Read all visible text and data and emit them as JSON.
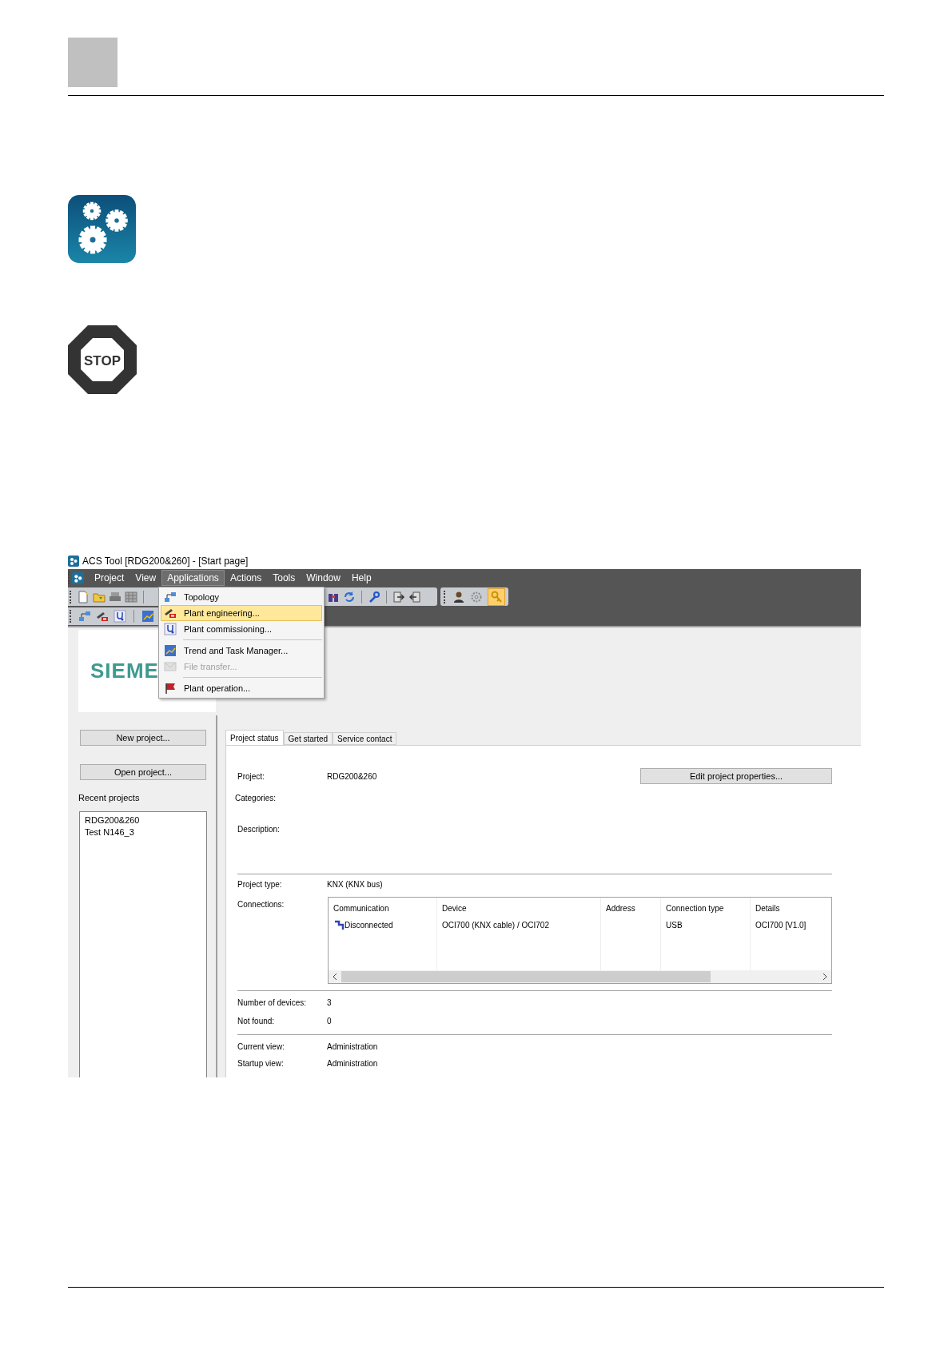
{
  "stop_sign": {
    "label": "STOP"
  },
  "window": {
    "title": "ACS Tool [RDG200&260] - [Start page]"
  },
  "menu": [
    {
      "label": "Project",
      "selected": false
    },
    {
      "label": "View",
      "selected": false
    },
    {
      "label": "Applications",
      "selected": true
    },
    {
      "label": "Actions",
      "selected": false
    },
    {
      "label": "Tools",
      "selected": false
    },
    {
      "label": "Window",
      "selected": false
    },
    {
      "label": "Help",
      "selected": false
    }
  ],
  "dropdown": [
    {
      "label": "Topology",
      "selected": false,
      "disabled": false,
      "separator_after": false
    },
    {
      "label": "Plant engineering...",
      "selected": true,
      "disabled": false,
      "separator_after": false
    },
    {
      "label": "Plant commissioning...",
      "selected": false,
      "disabled": false,
      "separator_after": true
    },
    {
      "label": "Trend and Task Manager...",
      "selected": false,
      "disabled": false,
      "separator_after": false
    },
    {
      "label": "File transfer...",
      "selected": false,
      "disabled": true,
      "separator_after": true
    },
    {
      "label": "Plant operation...",
      "selected": false,
      "disabled": false,
      "separator_after": false
    }
  ],
  "logo": {
    "text": "SIEME"
  },
  "sidebar": {
    "buttons": [
      "New project...",
      "Open project..."
    ],
    "recent_label": "Recent projects",
    "recent": [
      "RDG200&260",
      "Test N146_3"
    ]
  },
  "tabs": [
    {
      "label": "Project status",
      "selected": true
    },
    {
      "label": "Get started",
      "selected": false
    },
    {
      "label": "Service contact",
      "selected": false
    }
  ],
  "project": {
    "project_label": "Project:",
    "project_value": "RDG200&260",
    "edit_button": "Edit project properties...",
    "categories_label": "Categories:",
    "description_label": "Description:",
    "type_label": "Project type:",
    "type_value": "KNX (KNX bus)",
    "connections_label": "Connections:"
  },
  "connections": {
    "columns": [
      "Communication",
      "Device",
      "Address",
      "Connection type",
      "Details"
    ],
    "rows": [
      [
        "Disconnected",
        "OCI700 (KNX cable) / OCI702",
        "",
        "USB",
        "OCI700 [V1.0]"
      ]
    ]
  },
  "stats": [
    {
      "label": "Number of devices:",
      "value": "3"
    },
    {
      "label": "Not found:",
      "value": "0"
    }
  ],
  "views": [
    {
      "label": "Current view:",
      "value": "Administration"
    },
    {
      "label": "Startup view:",
      "value": "Administration"
    }
  ]
}
